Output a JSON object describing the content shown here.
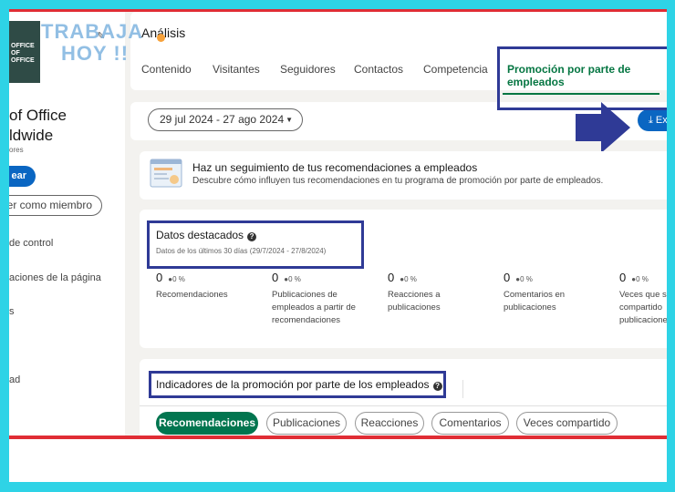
{
  "watermark": {
    "line1": "TRABAJA",
    "line2": "HOY !!"
  },
  "logo": {
    "line1": "OFFICE",
    "line2": "OF",
    "line3": "OFFICE"
  },
  "sidebar": {
    "company_name_1": "of Office",
    "company_name_2": "ldwide",
    "followers": "ores",
    "create_label": "ear",
    "view_member_label": "er como miembro",
    "items": [
      {
        "label": "de control"
      },
      {
        "label": "aciones de la página"
      },
      {
        "label": "s"
      },
      {
        "label": "ad"
      }
    ]
  },
  "header": {
    "title": "Análisis",
    "tabs": [
      {
        "label": "Contenido"
      },
      {
        "label": "Visitantes"
      },
      {
        "label": "Seguidores"
      },
      {
        "label": "Contactos"
      },
      {
        "label": "Competencia"
      }
    ],
    "active_tab": "Promoción por parte de empleados"
  },
  "toolbar": {
    "date_range": "29 jul 2024 - 27 ago 2024",
    "export_label": "Exp"
  },
  "info": {
    "title": "Haz un seguimiento de tus recomendaciones a empleados",
    "subtitle": "Descubre cómo influyen tus recomendaciones en tu programa de promoción por parte de empleados."
  },
  "highlights": {
    "title": "Datos destacados",
    "subtitle": "Datos de los últimos 30 días (29/7/2024 - 27/8/2024)",
    "metrics": [
      {
        "value": "0",
        "change": "●0 %",
        "label": "Recomendaciones"
      },
      {
        "value": "0",
        "change": "●0 %",
        "label": "Publicaciones de empleados a partir de recomendaciones"
      },
      {
        "value": "0",
        "change": "●0 %",
        "label": "Reacciones a publicaciones"
      },
      {
        "value": "0",
        "change": "●0 %",
        "label": "Comentarios en publicaciones"
      },
      {
        "value": "0",
        "change": "●0 %",
        "label": "Veces que se compartido publicaciones"
      }
    ]
  },
  "indicators": {
    "title": "Indicadores de la promoción por parte de los empleados",
    "pills": [
      {
        "label": "Recomendaciones"
      },
      {
        "label": "Publicaciones"
      },
      {
        "label": "Reacciones"
      },
      {
        "label": "Comentarios"
      },
      {
        "label": "Veces compartido"
      }
    ]
  },
  "colors": {
    "accent_green": "#057642",
    "primary_blue": "#0a66c2",
    "annotation_border": "#2f3a96",
    "frame_background": "#2ed3e6",
    "red_line": "#e02d35"
  }
}
